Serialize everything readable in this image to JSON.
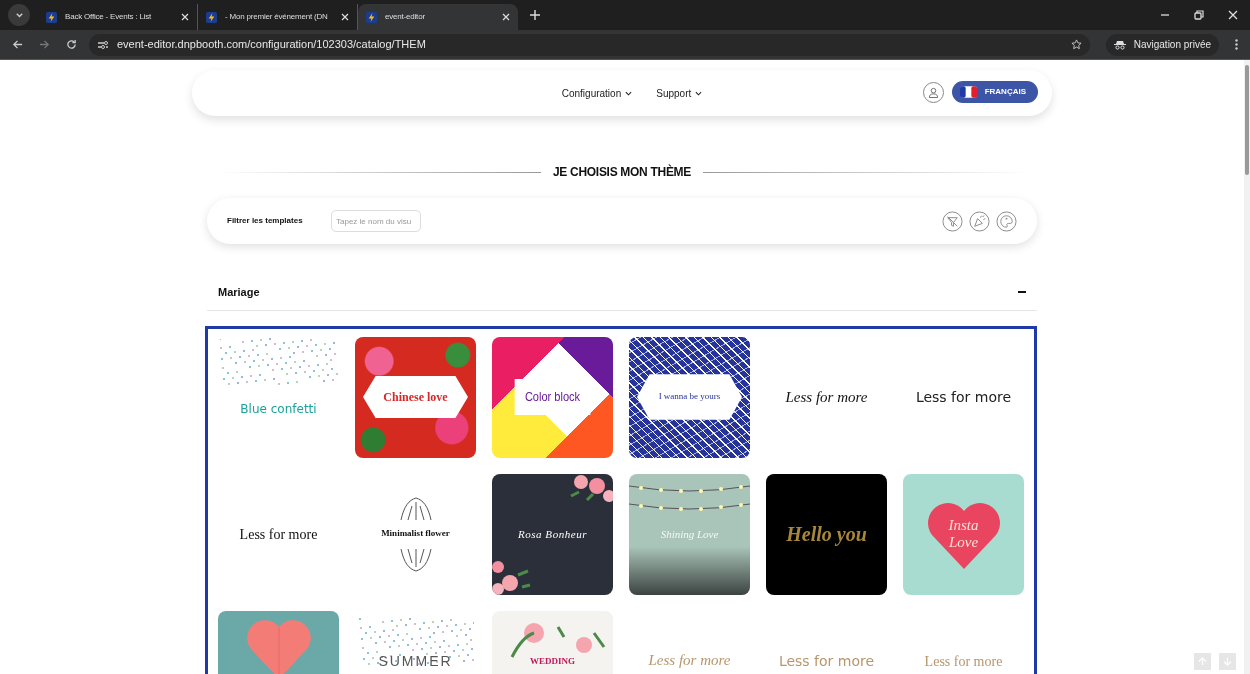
{
  "browser": {
    "tabs": [
      {
        "title": "Back Office - Events : List",
        "selected": false
      },
      {
        "title": "- Mon premier événement (DN",
        "selected": false
      },
      {
        "title": "event-editor",
        "selected": true
      }
    ],
    "url": "event-editor.dnpbooth.com/configuration/102303/catalog/THEM",
    "profile": "Navigation privée"
  },
  "nav": {
    "menus": [
      "Configuration",
      "Support"
    ],
    "language": "FRANÇAIS"
  },
  "heading": "JE CHOISIS MON THÈME",
  "filter": {
    "label": "Filtrer les templates",
    "placeholder": "Tapez le nom du visu"
  },
  "section": {
    "title": "Mariage",
    "expanded": true
  },
  "templates": [
    {
      "kind": "confetti",
      "label": "Blue confetti"
    },
    {
      "kind": "floral",
      "label": "Chinese love"
    },
    {
      "kind": "colorblock",
      "label": "Color block"
    },
    {
      "kind": "pattern",
      "label": "I wanna be yours"
    },
    {
      "kind": "script",
      "label": "Less for more"
    },
    {
      "kind": "sans",
      "label": "Less for more"
    },
    {
      "kind": "serif",
      "label": "Less for more"
    },
    {
      "kind": "sketch",
      "label": "Minimalist flower"
    },
    {
      "kind": "dark",
      "label": "Rosa Bonheur"
    },
    {
      "kind": "lights",
      "label": "Shining Love"
    },
    {
      "kind": "black",
      "label": "Hello you"
    },
    {
      "kind": "heart",
      "label": "Insta Love"
    },
    {
      "kind": "balloon"
    },
    {
      "kind": "summer",
      "label": "SUMMER"
    },
    {
      "kind": "wedding",
      "label": "WEDDING"
    },
    {
      "kind": "script-gold",
      "label": "Less for more"
    },
    {
      "kind": "sans-gold",
      "label": "Less for more"
    },
    {
      "kind": "serif-gold",
      "label": "Less for more"
    }
  ]
}
